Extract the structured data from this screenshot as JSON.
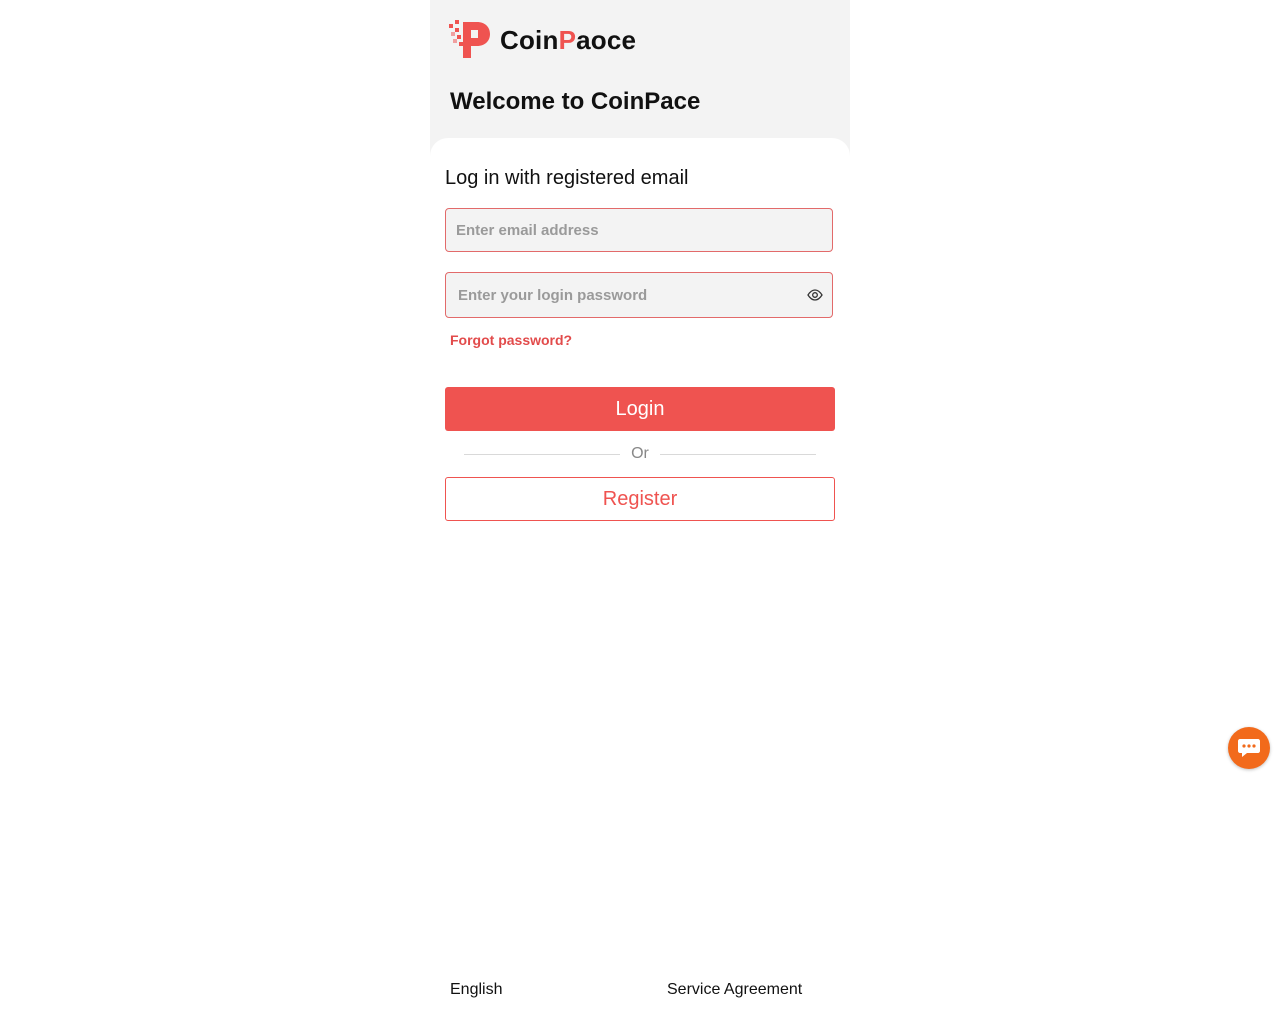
{
  "header": {
    "logo_icon": "coinpace-logo-icon",
    "brand_part1": "Coin",
    "brand_accent": "P",
    "brand_part2": "aoce",
    "welcome": "Welcome to CoinPace"
  },
  "login_form": {
    "subtitle": "Log in with registered email",
    "email_placeholder": "Enter email address",
    "email_value": "",
    "password_placeholder": "Enter your login password",
    "password_value": "",
    "password_toggle_icon": "eye-icon",
    "forgot_label": "Forgot password?",
    "login_label": "Login",
    "divider_label": "Or",
    "register_label": "Register"
  },
  "footer": {
    "language": "English",
    "agreement": "Service Agreement"
  },
  "chat": {
    "icon": "chat-bubble-icon"
  },
  "colors": {
    "accent": "#ef5350",
    "header_bg": "#f3f3f3",
    "chat_fab": "#f26a1b"
  }
}
